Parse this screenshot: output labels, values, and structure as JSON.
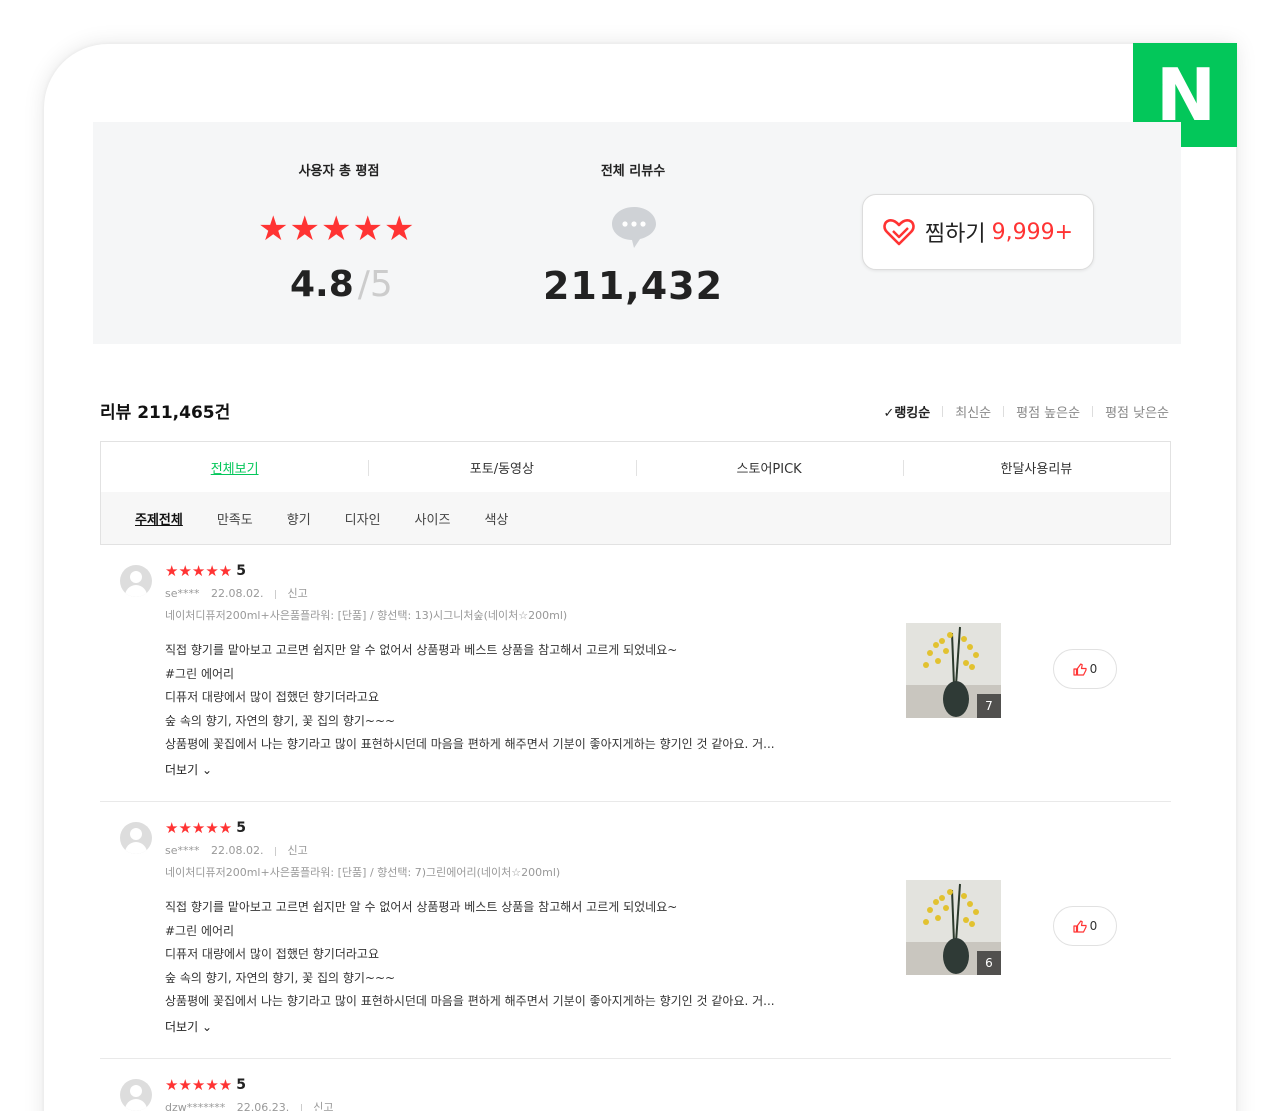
{
  "brand": {
    "logo_text": "N",
    "color": "#03c75a"
  },
  "summary": {
    "rating_label": "사용자 총 평점",
    "rating_value": "4.8",
    "rating_max": "/5",
    "rating_stars": 5,
    "reviews_label": "전체 리뷰수",
    "reviews_total": "211,432",
    "reviews_icon": "chat-bubble-icon"
  },
  "wish": {
    "icon": "heart-icon",
    "label": "찜하기",
    "count": "9,999+"
  },
  "reviews_header": {
    "count_label": "리뷰 211,465건",
    "sort": {
      "active": "랭킹순",
      "options": [
        "최신순",
        "평점 높은순",
        "평점 낮은순"
      ]
    }
  },
  "tabs": [
    "전체보기",
    "포토/동영상",
    "스토어PICK",
    "한달사용리뷰"
  ],
  "filters": [
    "주제전체",
    "만족도",
    "향기",
    "디자인",
    "사이즈",
    "색상"
  ],
  "review_list": [
    {
      "stars": "★★★★★",
      "score": "5",
      "user": "se****",
      "date": "22.08.02.",
      "report": "신고",
      "option": "네이처디퓨저200ml+사은품플라워: [단품] / 향선택: 13)시그니처숲(네이처☆200ml)",
      "lines": [
        "직접 향기를 맡아보고 고르면 쉽지만 알 수 없어서 상품평과 베스트 상품을 참고해서 고르게 되었네요~",
        "#그린 에어리",
        "디퓨저 대량에서 많이 접했던 향기더라고요",
        "숲 속의 향기, 자연의 향기, 꽃 집의 향기~~~",
        "상품평에 꽃집에서 나는 향기라고 많이 표현하시던데 마음을 편하게 해주면서 기분이 좋아지게하는 향기인 것 같아요. 거..."
      ],
      "more": "더보기",
      "photo_count": "7",
      "likes": "0"
    },
    {
      "stars": "★★★★★",
      "score": "5",
      "user": "se****",
      "date": "22.08.02.",
      "report": "신고",
      "option": "네이처디퓨저200ml+사은품플라워: [단품] / 향선택: 7)그린에어리(네이처☆200ml)",
      "lines": [
        "직접 향기를 맡아보고 고르면 쉽지만 알 수 없어서 상품평과 베스트 상품을 참고해서 고르게 되었네요~",
        "#그린 에어리",
        "디퓨저 대량에서 많이 접했던 향기더라고요",
        "숲 속의 향기, 자연의 향기, 꽃 집의 향기~~~",
        "상품평에 꽃집에서 나는 향기라고 많이 표현하시던데 마음을 편하게 해주면서 기분이 좋아지게하는 향기인 것 같아요. 거..."
      ],
      "more": "더보기",
      "photo_count": "6",
      "likes": "0"
    },
    {
      "stars": "★★★★★",
      "score": "5",
      "user": "dzw*******",
      "date": "22.06.23.",
      "report": "신고"
    }
  ]
}
